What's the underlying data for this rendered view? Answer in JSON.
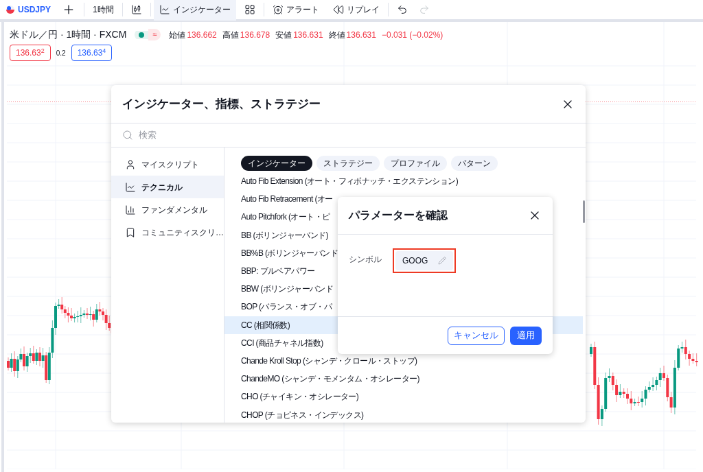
{
  "toolbar": {
    "symbol": "USDJPY",
    "interval": "1時間",
    "indicators": {
      "label": "インジケーター",
      "selected": true
    },
    "alerts": "アラート",
    "replay": "リプレイ",
    "redo_disabled": true
  },
  "legend": {
    "title": "米ドル／円 · 1時間 · FXCM",
    "status_symbol": "≈",
    "ohlc": [
      {
        "label": "始値",
        "value": "136.662"
      },
      {
        "label": "高値",
        "value": "136.678"
      },
      {
        "label": "安値",
        "value": "136.631"
      },
      {
        "label": "終値",
        "value": "136.631"
      }
    ],
    "change": "−0.031 (−0.02%)",
    "bid": "136.63$^{2}$",
    "spread": "0.2",
    "ask": "136.63$^{4}$"
  },
  "dialog": {
    "title": "インジケーター、指標、ストラテジー",
    "search_placeholder": "検索",
    "sidebar": [
      {
        "label": "マイスクリプト",
        "selected": false
      },
      {
        "label": "テクニカル",
        "selected": true
      },
      {
        "label": "ファンダメンタル",
        "selected": false
      },
      {
        "label": "コミュニティスクリ…",
        "selected": false
      }
    ],
    "tabs": [
      {
        "label": "インジケーター",
        "selected": true
      },
      {
        "label": "ストラテジー",
        "selected": false
      },
      {
        "label": "プロファイル",
        "selected": false
      },
      {
        "label": "パターン",
        "selected": false
      }
    ],
    "items": [
      {
        "label": "Auto Fib Extension (オート・フィボナッチ・エクステンション)",
        "selected": false
      },
      {
        "label": "Auto Fib Retracement (オー",
        "selected": false
      },
      {
        "label": "Auto Pitchfork (オート・ピ",
        "selected": false
      },
      {
        "label": "BB (ボリンジャーバンド)",
        "selected": false
      },
      {
        "label": "BB%B (ボリンジャーバンド",
        "selected": false
      },
      {
        "label": "BBP: ブルベアパワー",
        "selected": false
      },
      {
        "label": "BBW (ボリンジャーバンド",
        "selected": false
      },
      {
        "label": "BOP (バランス・オブ・パ",
        "selected": false
      },
      {
        "label": "CC (相関係数)",
        "selected": true
      },
      {
        "label": "CCI (商品チャネル指数)",
        "selected": false
      },
      {
        "label": "Chande Kroll Stop (シャンデ・クロール・ストップ)",
        "selected": false
      },
      {
        "label": "ChandeMO (シャンデ・モメンタム・オシレーター)",
        "selected": false
      },
      {
        "label": "CHO (チャイキン・オシレーター)",
        "selected": false
      },
      {
        "label": "CHOP (チョピネス・インデックス)",
        "selected": false
      }
    ]
  },
  "param_dialog": {
    "title": "パラメーターを確認",
    "field_label": "シンボル",
    "field_value": "GOOG",
    "highlighted": true,
    "cancel": "キャンセル",
    "apply": "適用"
  }
}
